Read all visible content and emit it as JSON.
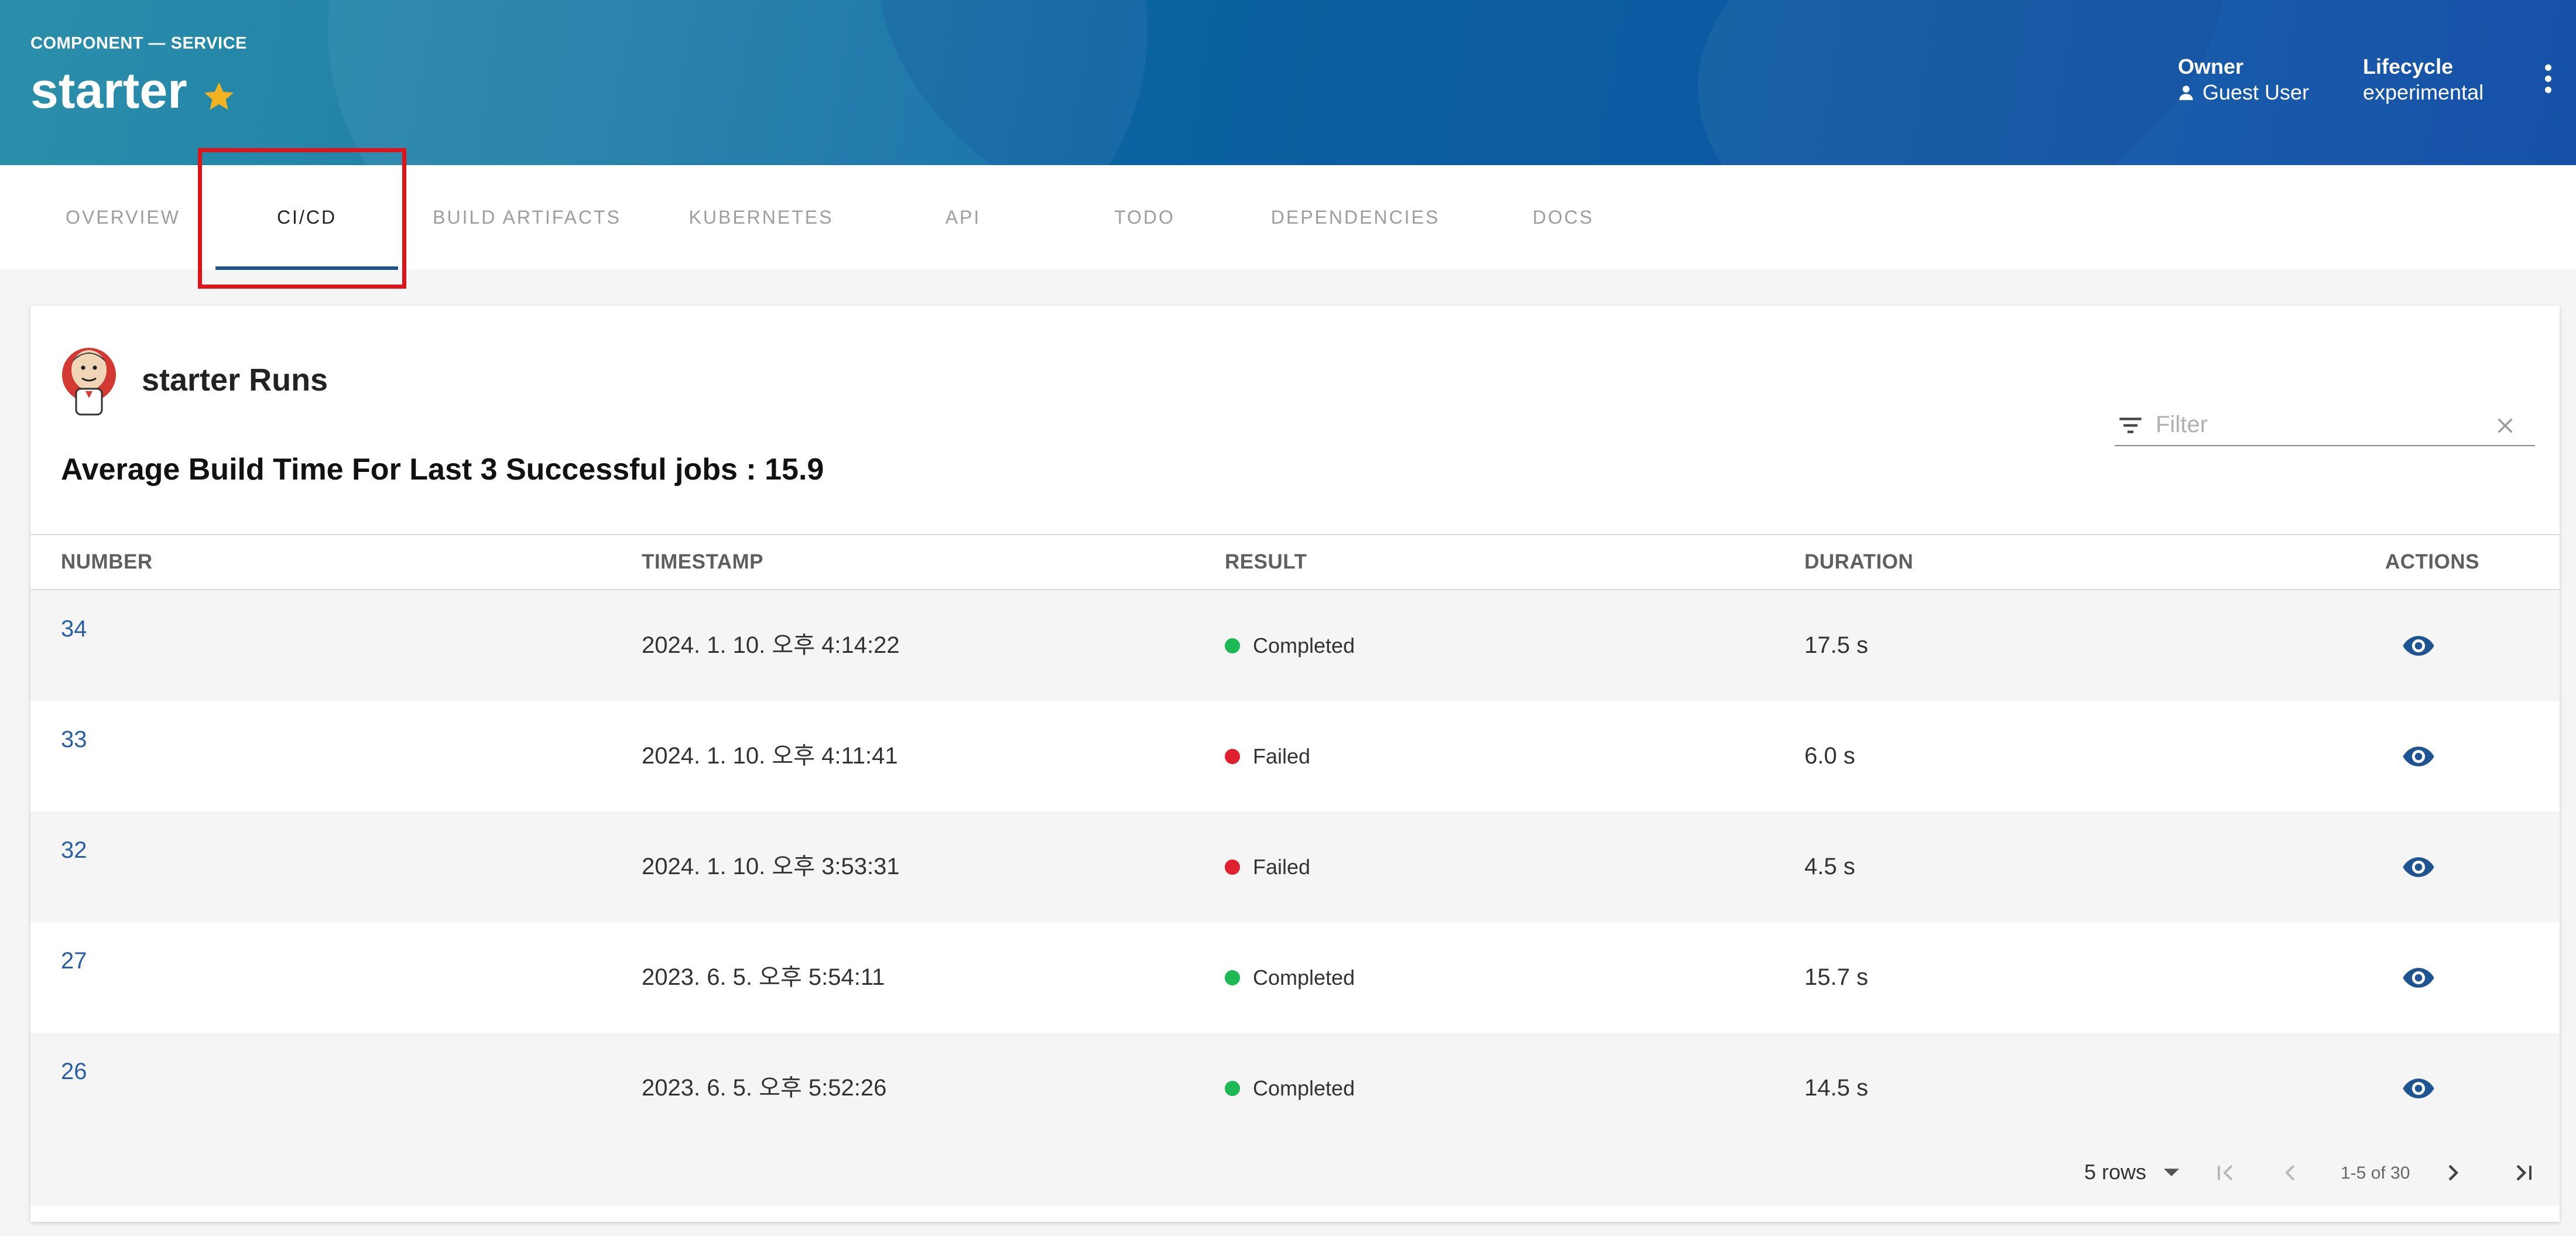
{
  "header": {
    "kind": "COMPONENT — SERVICE",
    "title": "starter",
    "owner_label": "Owner",
    "owner_value": "Guest User",
    "lifecycle_label": "Lifecycle",
    "lifecycle_value": "experimental"
  },
  "tabs": [
    {
      "label": "OVERVIEW"
    },
    {
      "label": "CI/CD"
    },
    {
      "label": "BUILD ARTIFACTS"
    },
    {
      "label": "KUBERNETES"
    },
    {
      "label": "API"
    },
    {
      "label": "TODO"
    },
    {
      "label": "DEPENDENCIES"
    },
    {
      "label": "DOCS"
    }
  ],
  "active_tab": "CI/CD",
  "card": {
    "title": "starter Runs",
    "average_text": "Average Build Time For Last 3 Successful jobs : 15.9",
    "filter_placeholder": "Filter"
  },
  "table": {
    "columns": [
      "NUMBER",
      "TIMESTAMP",
      "RESULT",
      "DURATION",
      "ACTIONS"
    ],
    "rows": [
      {
        "number": "34",
        "timestamp": "2024. 1. 10. 오후 4:14:22",
        "result": "Completed",
        "duration": "17.5 s"
      },
      {
        "number": "33",
        "timestamp": "2024. 1. 10. 오후 4:11:41",
        "result": "Failed",
        "duration": "6.0 s"
      },
      {
        "number": "32",
        "timestamp": "2024. 1. 10. 오후 3:53:31",
        "result": "Failed",
        "duration": "4.5 s"
      },
      {
        "number": "27",
        "timestamp": "2023. 6. 5. 오후 5:54:11",
        "result": "Completed",
        "duration": "15.7 s"
      },
      {
        "number": "26",
        "timestamp": "2023. 6. 5. 오후 5:52:26",
        "result": "Completed",
        "duration": "14.5 s"
      }
    ]
  },
  "pagination": {
    "rows_label": "5 rows",
    "range_label": "1-5 of 30"
  },
  "colors": {
    "completed": "#1db954",
    "failed": "#e0202f",
    "accent": "#1f5493",
    "highlight": "#e0131a",
    "star": "#f3b21f"
  },
  "icons": [
    "star-icon",
    "person-icon",
    "more-vert-icon",
    "jenkins-logo-icon",
    "filter-icon",
    "clear-icon",
    "eye-icon",
    "first-page-icon",
    "prev-page-icon",
    "next-page-icon",
    "last-page-icon"
  ]
}
